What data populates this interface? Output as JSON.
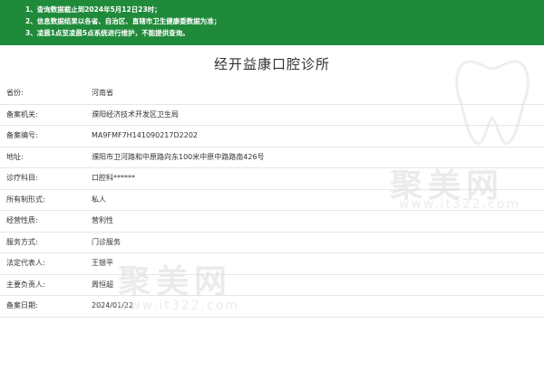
{
  "notice": {
    "lines": [
      "1、查询数据截止到2024年5月12日23时；",
      "2、信息数据结果以各省、自治区、直辖市卫生健康委数据为准；",
      "3、凌晨1点至凌晨5点系统进行维护，不能提供查询。"
    ]
  },
  "page_title": "经开益康口腔诊所",
  "rows": [
    {
      "label": "省份:",
      "value": "河南省"
    },
    {
      "label": "备案机关:",
      "value": "濮阳经济技术开发区卫生局"
    },
    {
      "label": "备案编号:",
      "value": "MA9FMF7H141090217D2202"
    },
    {
      "label": "地址:",
      "value": "濮阳市卫河路和中原路向东100米中原中路路南426号"
    },
    {
      "label": "诊疗科目:",
      "value": "口腔科******"
    },
    {
      "label": "所有制形式:",
      "value": "私人"
    },
    {
      "label": "经营性质:",
      "value": "营利性"
    },
    {
      "label": "服务方式:",
      "value": "门诊服务"
    },
    {
      "label": "法定代表人:",
      "value": "王银平"
    },
    {
      "label": "主要负责人:",
      "value": "周恒超"
    },
    {
      "label": "备案日期:",
      "value": "2024/01/22"
    }
  ],
  "watermark": {
    "brand": "聚美网",
    "url": "www.it322.com"
  },
  "colors": {
    "notice_bg": "#1f8a3a",
    "divider": "#e6e6e6"
  }
}
